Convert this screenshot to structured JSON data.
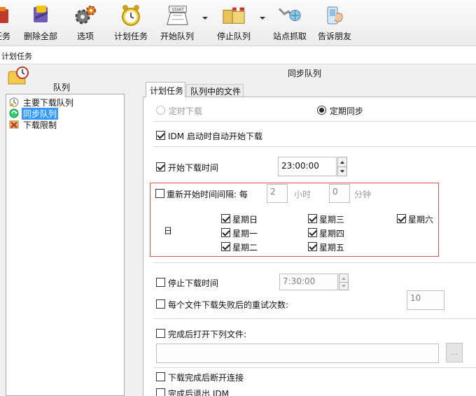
{
  "toolbar": {
    "items": [
      {
        "label": "任务",
        "icon": "task-icon"
      },
      {
        "label": "删除全部",
        "icon": "delete-all-icon"
      },
      {
        "label": "选项",
        "icon": "gears-icon"
      },
      {
        "label": "计划任务",
        "icon": "alarm-clock-icon"
      },
      {
        "label": "开始队列",
        "icon": "start-queue-icon"
      },
      {
        "label": "停止队列",
        "icon": "stop-queue-icon"
      },
      {
        "label": "站点抓取",
        "icon": "site-grabber-icon"
      },
      {
        "label": "告诉朋友",
        "icon": "tell-friend-icon"
      }
    ]
  },
  "dialog": {
    "title": "计划任务"
  },
  "sidebar": {
    "header": "队列",
    "items": [
      {
        "label": "主要下载队列",
        "icon": "main-queue-icon",
        "selected": false
      },
      {
        "label": "同步队列",
        "icon": "sync-queue-icon",
        "selected": true
      },
      {
        "label": "下载限制",
        "icon": "download-limit-icon",
        "selected": false
      }
    ]
  },
  "panel": {
    "title": "同步队列",
    "tabs": [
      {
        "label": "计划任务",
        "active": true
      },
      {
        "label": "队列中的文件",
        "active": false
      }
    ]
  },
  "schedule": {
    "mode_one_time": "定时下载",
    "mode_periodic": "定期同步",
    "mode_selected": "定期同步",
    "start_on_idm": {
      "label": "IDM 启动时自动开始下载",
      "checked": true
    },
    "start_time": {
      "label": "开始下载时间",
      "checked": true,
      "value": "23:00:00"
    },
    "restart_interval": {
      "label": "重新开始时间间隔: 每",
      "checked": false,
      "hours": "2",
      "hours_unit": "小时",
      "minutes": "0",
      "minutes_unit": "分钟"
    },
    "days_label": "日",
    "days": [
      {
        "label": "星期日",
        "checked": true
      },
      {
        "label": "星期一",
        "checked": true
      },
      {
        "label": "星期二",
        "checked": true
      },
      {
        "label": "星期三",
        "checked": true
      },
      {
        "label": "星期四",
        "checked": true
      },
      {
        "label": "星期五",
        "checked": true
      },
      {
        "label": "星期六",
        "checked": true
      }
    ],
    "stop_time": {
      "label": "停止下载时间",
      "checked": false,
      "value": "7:30:00"
    },
    "retries": {
      "label": "每个文件下载失败后的重试次数:",
      "checked": false,
      "value": "10"
    },
    "open_file": {
      "label": "完成后打开下列文件:",
      "checked": false,
      "path": "",
      "browse_label": "..."
    },
    "hangup": {
      "label": "下载完成后断开连接",
      "checked": false
    },
    "exit_idm": {
      "label": "完成后退出 IDM",
      "checked": false
    }
  },
  "colors": {
    "highlight": "#d9534f",
    "selection": "#3399ff"
  }
}
